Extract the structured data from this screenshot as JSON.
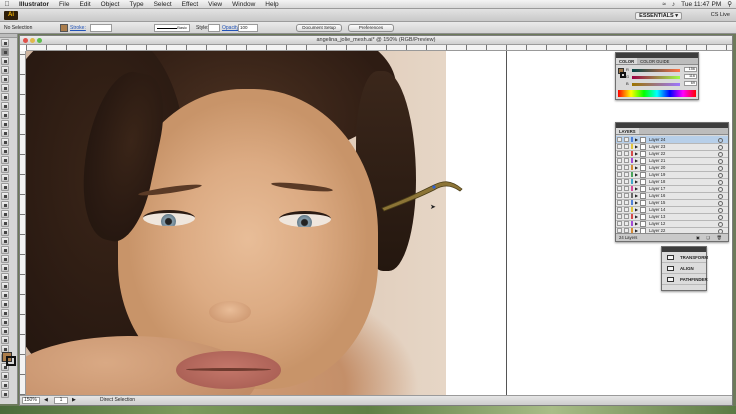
{
  "menubar": {
    "app": "Illustrator",
    "items": [
      "File",
      "Edit",
      "Object",
      "Type",
      "Select",
      "Effect",
      "View",
      "Window",
      "Help"
    ],
    "clock": "Tue 11:47 PM"
  },
  "appbar": {
    "logo": "Ai",
    "workspace": "ESSENTIALS ▾",
    "cs_live": "CS Live"
  },
  "controlbar": {
    "selection": "No Selection",
    "stroke_label": "Stroke:",
    "stroke_value": "",
    "brush": "Basic",
    "style_label": "Style:",
    "opacity_label": "Opacity:",
    "opacity_value": "100",
    "doc_setup": "Document Setup",
    "preferences": "Preferences",
    "fill_color": "#ab7d4b"
  },
  "document": {
    "title": "angelina_jolie_mesh.ai* @ 150% (RGB/Preview)",
    "zoom": "150%",
    "page": "1",
    "status_tool": "Direct Selection"
  },
  "color_panel": {
    "tabs": [
      "COLOR",
      "COLOR GUIDE"
    ],
    "channels": [
      {
        "label": "R",
        "value": "156"
      },
      {
        "label": "G",
        "value": "116"
      },
      {
        "label": "B",
        "value": "69"
      }
    ]
  },
  "layers_panel": {
    "title": "LAYERS",
    "count": "24 Layers",
    "layers": [
      {
        "name": "Layer 24",
        "color": "#4f7fd8",
        "selected": true
      },
      {
        "name": "Layer 23",
        "color": "#e0c43a",
        "selected": false
      },
      {
        "name": "Layer 22",
        "color": "#d44b4b",
        "selected": false
      },
      {
        "name": "Layer 21",
        "color": "#a24bd4",
        "selected": false
      },
      {
        "name": "Layer 20",
        "color": "#d48a36",
        "selected": false
      },
      {
        "name": "Layer 19",
        "color": "#48a35a",
        "selected": false
      },
      {
        "name": "Layer 18",
        "color": "#3fa7c8",
        "selected": false
      },
      {
        "name": "Layer 17",
        "color": "#d44b9c",
        "selected": false
      },
      {
        "name": "Layer 16",
        "color": "#6b6b6b",
        "selected": false
      },
      {
        "name": "Layer 15",
        "color": "#4f7fd8",
        "selected": false
      },
      {
        "name": "Layer 14",
        "color": "#e0c43a",
        "selected": false
      },
      {
        "name": "Layer 13",
        "color": "#d44b4b",
        "selected": false
      },
      {
        "name": "Layer 12",
        "color": "#a24bd4",
        "selected": false
      },
      {
        "name": "Layer 22",
        "color": "#d48a36",
        "selected": false
      }
    ]
  },
  "docked_panel": {
    "items": [
      "TRANSFORM",
      "ALIGN",
      "PATHFINDER"
    ]
  }
}
